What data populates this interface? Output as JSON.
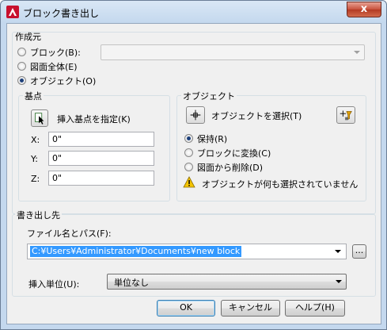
{
  "window": {
    "title": "ブロック書き出し",
    "close_label": "x"
  },
  "source": {
    "title": "作成元",
    "options": [
      {
        "label": "ブロック(B):",
        "checked": false
      },
      {
        "label": "図面全体(E)",
        "checked": false
      },
      {
        "label": "オブジェクト(O)",
        "checked": true
      }
    ],
    "block_combo_value": ""
  },
  "base_point": {
    "title": "基点",
    "pick_label": "挿入基点を指定(K)",
    "x_label": "X:",
    "x_value": "0\"",
    "y_label": "Y:",
    "y_value": "0\"",
    "z_label": "Z:",
    "z_value": "0\""
  },
  "objects": {
    "title": "オブジェクト",
    "select_label": "オブジェクトを選択(T)",
    "options": [
      {
        "label": "保持(R)",
        "checked": true
      },
      {
        "label": "ブロックに変換(C)",
        "checked": false
      },
      {
        "label": "図面から削除(D)",
        "checked": false
      }
    ],
    "warning": "オブジェクトが何も選択されていません"
  },
  "destination": {
    "title": "書き出し先",
    "file_label": "ファイル名とパス(F):",
    "file_value": "C:¥Users¥Administrator¥Documents¥new block",
    "browse_label": "...",
    "units_label": "挿入単位(U):",
    "units_value": "単位なし"
  },
  "buttons": {
    "ok": "OK",
    "cancel": "キャンセル",
    "help": "ヘルプ(H)"
  },
  "colors": {
    "accent": "#3399ff",
    "title_gradient": "#c4d8ee",
    "warning": "#f5c400"
  }
}
